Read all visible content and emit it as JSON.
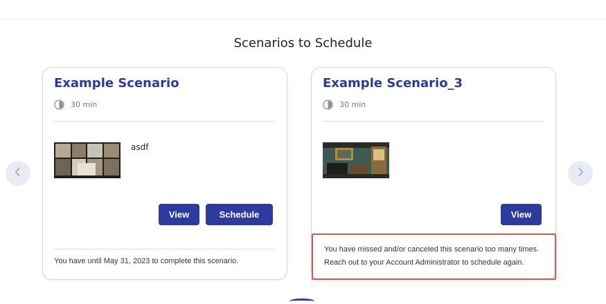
{
  "page": {
    "section_title": "Scenarios to Schedule"
  },
  "navigation": {
    "prev_icon": "chevron-left-icon",
    "next_icon": "chevron-right-icon"
  },
  "cards": [
    {
      "title": "Example Scenario",
      "duration": "30 min",
      "description": "asdf",
      "buttons": {
        "view": "View",
        "schedule": "Schedule"
      },
      "footer_note": "You have until May 31, 2023 to complete this scenario."
    },
    {
      "title": "Example Scenario_3",
      "duration": "30 min",
      "description": "",
      "buttons": {
        "view": "View"
      },
      "warning_line_1": "You have missed and/or canceled this scenario too many times.",
      "warning_line_2": "Reach out to your Account Administrator to schedule again."
    }
  ],
  "colors": {
    "accent": "#2d3a9f",
    "title": "#2c3b9b",
    "warning_border": "#d9534f"
  }
}
